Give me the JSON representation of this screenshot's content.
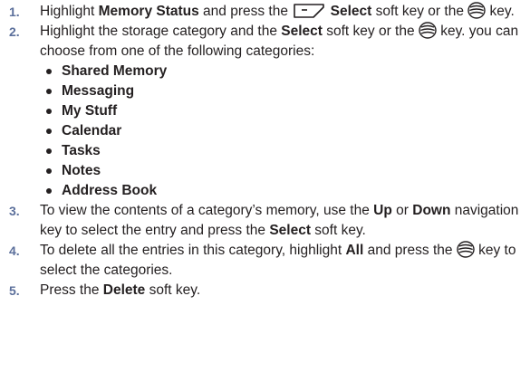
{
  "steps": [
    {
      "number": "1.",
      "parts": {
        "a": "Highlight ",
        "b": "Memory Status",
        "c": " and press the ",
        "d": "Select",
        "e": " soft key or the ",
        "f": " key."
      }
    },
    {
      "number": "2.",
      "parts": {
        "a": "Highlight the storage category and the ",
        "b": "Select",
        "c": " soft key or the ",
        "d": " key. you can choose from one of the following categories:"
      },
      "categories": [
        "Shared Memory",
        "Messaging",
        "My Stuff",
        "Calendar",
        "Tasks",
        "Notes",
        "Address Book"
      ]
    },
    {
      "number": "3.",
      "parts": {
        "a": "To view the contents of a category’s memory, use the ",
        "b": "Up",
        "c": " or ",
        "d": "Down",
        "e": " navigation key to select the entry and press the ",
        "f": "Select",
        "g": " soft key."
      }
    },
    {
      "number": "4.",
      "parts": {
        "a": "To delete all the entries in this category, highlight ",
        "b": "All",
        "c": " and press the ",
        "d": " key to select the categories."
      }
    },
    {
      "number": "5.",
      "parts": {
        "a": "Press the ",
        "b": "Delete",
        "c": " soft key."
      }
    }
  ],
  "icons": {
    "soft_key": "left-soft-key-icon",
    "ok_key": "ok-key-icon"
  }
}
